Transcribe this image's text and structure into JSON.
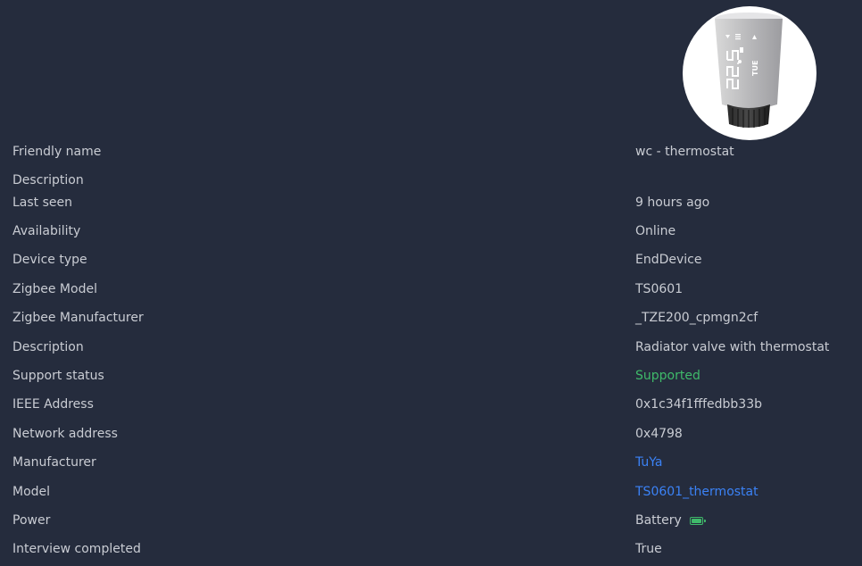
{
  "device": {
    "image_alt": "thermostat-valve",
    "display_reading": "22.5"
  },
  "rows": [
    {
      "label": "Friendly name",
      "value": "wc - thermostat"
    },
    {
      "label": "Description",
      "value": ""
    },
    {
      "label": "Last seen",
      "value": "9 hours ago"
    },
    {
      "label": "Availability",
      "value": "Online"
    },
    {
      "label": "Device type",
      "value": "EndDevice"
    },
    {
      "label": "Zigbee Model",
      "value": "TS0601"
    },
    {
      "label": "Zigbee Manufacturer",
      "value": "_TZE200_cpmgn2cf"
    },
    {
      "label": "Description",
      "value": "Radiator valve with thermostat"
    },
    {
      "label": "Support status",
      "value": "Supported"
    },
    {
      "label": "IEEE Address",
      "value": "0x1c34f1fffedbb33b"
    },
    {
      "label": "Network address",
      "value": "0x4798"
    },
    {
      "label": "Manufacturer",
      "value": "TuYa"
    },
    {
      "label": "Model",
      "value": "TS0601_thermostat"
    },
    {
      "label": "Power",
      "value": "Battery",
      "icon": "battery-icon"
    },
    {
      "label": "Interview completed",
      "value": "True"
    }
  ],
  "colors": {
    "background": "#252c3d",
    "text": "#c9ccd3",
    "link": "#3b82f6",
    "success": "#3fba6a"
  }
}
